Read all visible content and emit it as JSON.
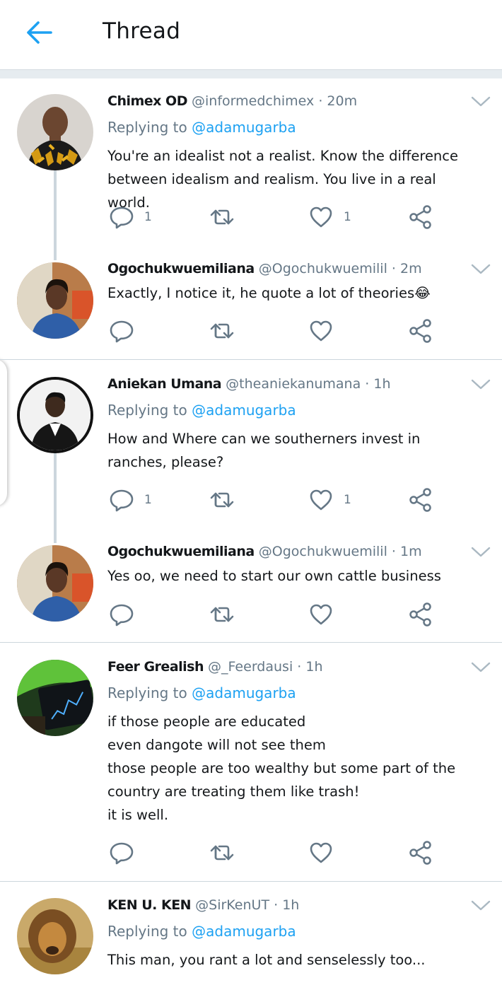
{
  "header": {
    "title": "Thread"
  },
  "tweets": [
    {
      "name": "Chimex OD",
      "handle": "@informedchimex",
      "time": "20m",
      "replying_prefix": "Replying to ",
      "replying_to": "@adamugarba",
      "text": "You're an idealist not a realist. Know the difference between idealism and realism. You live in a real world.",
      "reply_count": "1",
      "like_count": "1"
    },
    {
      "name": "Ogochukwuemiliana",
      "handle": "@Ogochukwuemilil",
      "time": "2m",
      "text": "Exactly, I notice it, he quote a lot of theories😂",
      "reply_count": "",
      "like_count": ""
    },
    {
      "name": "Aniekan Umana",
      "handle": "@theaniekanumana",
      "time": "1h",
      "replying_prefix": "Replying to ",
      "replying_to": "@adamugarba",
      "text": "How and Where can we southerners invest in ranches, please?",
      "reply_count": "1",
      "like_count": "1"
    },
    {
      "name": "Ogochukwuemiliana",
      "handle": "@Ogochukwuemilil",
      "time": "1m",
      "text": "Yes oo, we need to start our own cattle business",
      "reply_count": "",
      "like_count": ""
    },
    {
      "name": "Feer Grealish",
      "handle": "@_Feerdausi",
      "time": "1h",
      "replying_prefix": "Replying to ",
      "replying_to": "@adamugarba",
      "text": "if those people are educated\neven dangote will not see them\nthose people are too wealthy but some part of the country are treating them like trash!\nit is well.",
      "reply_count": "",
      "like_count": ""
    },
    {
      "name": "KEN U. KEN",
      "handle": "@SirKenUT",
      "time": "1h",
      "replying_prefix": "Replying to ",
      "replying_to": "@adamugarba",
      "text": "This man, you rant a lot and senselessly too..."
    }
  ],
  "separator": "·",
  "icons": [
    "back-arrow-icon",
    "chevron-down-icon",
    "reply-icon",
    "retweet-icon",
    "like-icon",
    "share-icon"
  ],
  "colors": {
    "accent": "#1da1f2",
    "secondary_text": "#657786",
    "divider": "#ccd6dd"
  }
}
